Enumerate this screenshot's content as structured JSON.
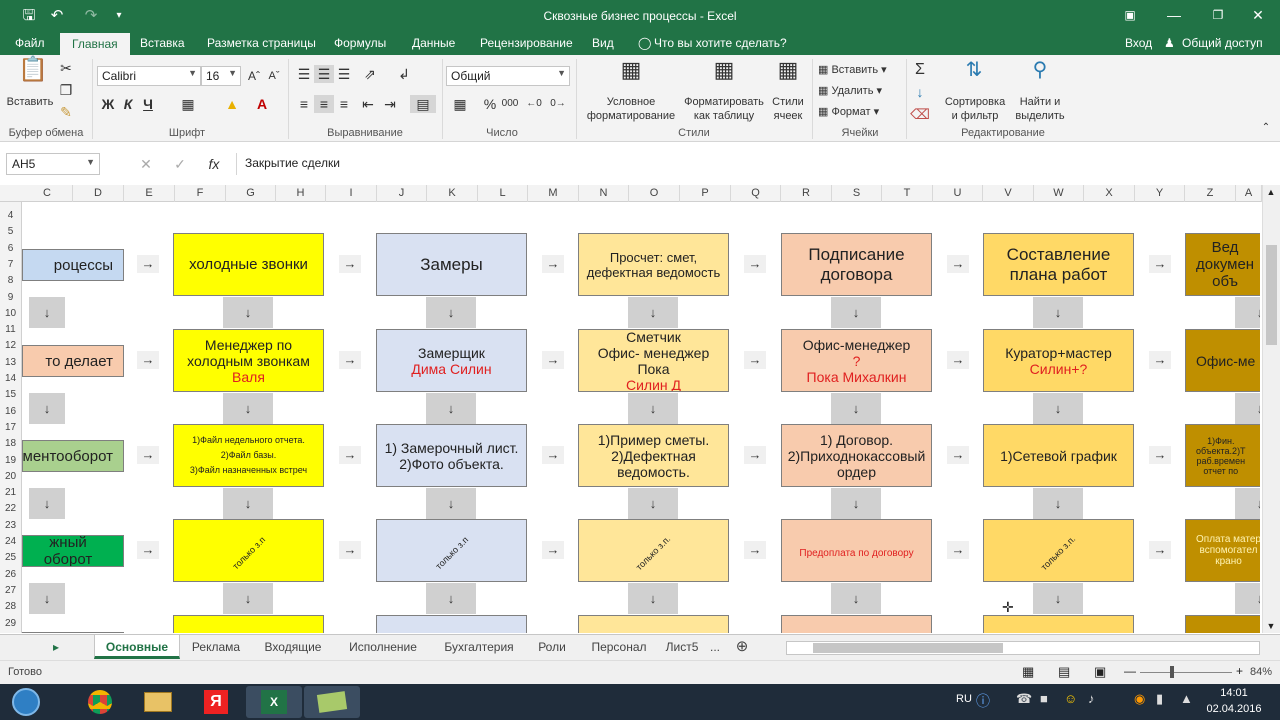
{
  "window": {
    "title": "Сквозные бизнес процессы - Excel"
  },
  "ribbon_tabs": [
    "Файл",
    "Главная",
    "Вставка",
    "Разметка страницы",
    "Формулы",
    "Данные",
    "Рецензирование",
    "Вид"
  ],
  "tell_me": "Что вы хотите сделать?",
  "account": {
    "signin": "Вход",
    "share": "Общий доступ"
  },
  "ribbon": {
    "paste": "Вставить",
    "clipboard_group": "Буфер обмена",
    "font_name": "Calibri",
    "font_size": "16",
    "font_group": "Шрифт",
    "bold": "Ж",
    "italic": "К",
    "underline": "Ч",
    "align_group": "Выравнивание",
    "number_format": "Общий",
    "number_group": "Число",
    "cond_format": "Условное\nформатирование",
    "format_table": "Форматировать\nкак таблицу",
    "cell_styles": "Стили\nячеек",
    "styles_group": "Стили",
    "insert": "Вставить",
    "delete": "Удалить",
    "format": "Формат",
    "cells_group": "Ячейки",
    "sort": "Сортировка\nи фильтр",
    "find": "Найти и\nвыделить",
    "edit_group": "Редактирование"
  },
  "formula_bar": {
    "name_box": "AH5",
    "formula": "Закрытие сделки"
  },
  "columns": [
    "C",
    "D",
    "E",
    "F",
    "G",
    "H",
    "I",
    "J",
    "K",
    "L",
    "M",
    "N",
    "O",
    "P",
    "Q",
    "R",
    "S",
    "T",
    "U",
    "V",
    "W",
    "X",
    "Y",
    "Z",
    "A"
  ],
  "rows": [
    "4",
    "5",
    "6",
    "7",
    "8",
    "9",
    "10",
    "11",
    "12",
    "13",
    "14",
    "15",
    "16",
    "17",
    "18",
    "19",
    "20",
    "21",
    "22",
    "23",
    "24",
    "25",
    "26",
    "27",
    "28",
    "29"
  ],
  "rows_legend": [
    {
      "text": "роцессы",
      "color": "#c5d9f1"
    },
    {
      "text": "то делает",
      "color": "#f8cbad"
    },
    {
      "text": "ментооборот",
      "color": "#a9d08e"
    },
    {
      "text": "жный оборот",
      "color": "#00b050"
    }
  ],
  "process_grid": [
    [
      {
        "text": "холодные звонки",
        "color": "#ffff00"
      },
      {
        "text": "Замеры",
        "color": "#d9e1f2"
      },
      {
        "text": "Просчет:     смет,\nдефектная ведомость",
        "color": "#ffe699"
      },
      {
        "text": "Подписание\nдоговора",
        "color": "#f8cbad"
      },
      {
        "text": "Составление\nплана работ",
        "color": "#ffd966"
      },
      {
        "text": "Вед\nдокумен\nобъ",
        "color": "#bf8f00"
      }
    ],
    [
      {
        "text": "Менеджер по\nхолодным звонкам",
        "red": "Валя",
        "color": "#ffff00"
      },
      {
        "text": "Замерщик",
        "red": "Дима Силин",
        "color": "#d9e1f2"
      },
      {
        "text": "Сметчик\nОфис- менеджер\nПока ",
        "red": "Силин Д",
        "color": "#ffe699"
      },
      {
        "text": "Офис-менеджер",
        "red": "?\nПока Михалкин",
        "color": "#f8cbad"
      },
      {
        "text": "Куратор+мастер",
        "red": "Силин+?",
        "color": "#ffd966"
      },
      {
        "text": "Офис-ме",
        "color": "#bf8f00"
      }
    ],
    [
      {
        "text": "1)Файл недельного отчета.\n2)Файл базы.\n3)Файл назначенных встреч",
        "color": "#ffff00"
      },
      {
        "text": "1) Замерочный лист.\n2)Фото объекта.",
        "color": "#d9e1f2"
      },
      {
        "text": "1)Пример сметы.\n2)Дефектная\nведомость.",
        "color": "#ffe699"
      },
      {
        "text": "1) Договор.\n2)Приходнокассовый\nордер",
        "color": "#f8cbad"
      },
      {
        "text": "1)Сетевой график",
        "color": "#ffd966"
      },
      {
        "text": "1)Фин.\nобъекта.2)Т\nраб.времен\nотчет по",
        "color": "#bf8f00"
      }
    ],
    [
      {
        "rot": "только з.п",
        "color": "#ffff00"
      },
      {
        "rot": "только з.п",
        "color": "#d9e1f2"
      },
      {
        "rot": "только з.п.",
        "color": "#ffe699"
      },
      {
        "red": "Предоплата по договору",
        "color": "#f8cbad"
      },
      {
        "rot": "только з.п.",
        "color": "#ffd966"
      },
      {
        "text": "Оплата матер\nвспомогател\nкрано",
        "color": "#bf8f00",
        "light": true
      }
    ]
  ],
  "sheet_tabs": [
    "Основные",
    "Реклама",
    "Входящие",
    "Исполнение",
    "Бухгалтерия",
    "Роли",
    "Персонал",
    "Лист5",
    "..."
  ],
  "status": {
    "ready": "Готово",
    "zoom": "84%"
  },
  "taskbar": {
    "lang": "RU",
    "time": "14:01",
    "date": "02.04.2016"
  },
  "accent": "#217346"
}
